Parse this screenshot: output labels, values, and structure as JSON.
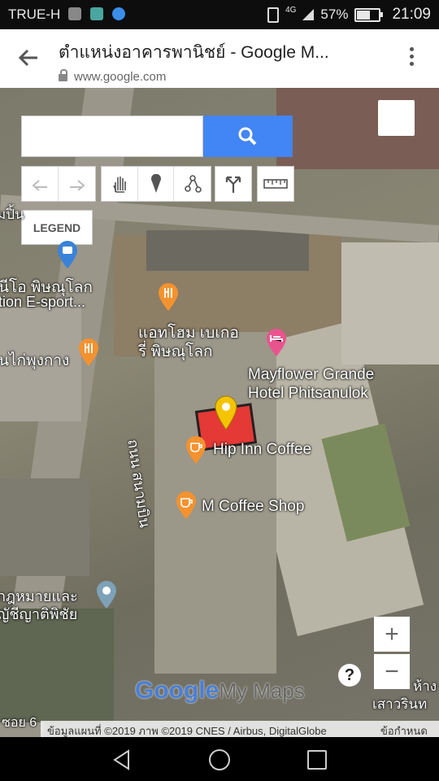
{
  "status_bar": {
    "carrier": "TRUE-H",
    "network": "4G",
    "battery": "57%",
    "battery_level": 0.57,
    "time": "21:09"
  },
  "browser": {
    "title": "ตำแหน่งอาคารพานิชย์ - Google M...",
    "url": "www.google.com"
  },
  "map": {
    "search": {
      "placeholder": "",
      "value": ""
    },
    "legend_label": "LEGEND",
    "zoom_in": "+",
    "zoom_out": "−",
    "help": "?",
    "labels": {
      "top_left_partial": "มปิ้น",
      "place_left_1a": "นีโอ พิษณุโลก",
      "place_left_1b": "tion E-sport...",
      "place_left_2": "นไก่พุงกาง",
      "bakery_a": "แอทโฮม เบเกอ",
      "bakery_b": "รี่ พิษณุโลก",
      "hotel_a": "Mayflower Grande",
      "hotel_b": "Hotel Phitsanulok",
      "cafe_1": "Hip Inn Coffee",
      "cafe_2": "M Coffee Shop",
      "road": "ถนน สนามบิน",
      "law_a": "กฎหมายและ",
      "law_b": "ญัชีญาติพิชัย",
      "right_a": "ห้าง",
      "right_b": "เสาวรินท",
      "soi": "ซอย 6",
      "brand_google": "Google",
      "brand_mymaps": "My Maps"
    },
    "attribution": {
      "text": "ข้อมูลแผนที่ ©2019 ภาพ ©2019 CNES / Airbus, DigitalGlobe",
      "terms": "ข้อกำหนด"
    }
  },
  "colors": {
    "search_button": "#4285f4",
    "poi_orange": "#f4922f",
    "poi_pink": "#e9548e",
    "marker_yellow": "#f5c400",
    "polygon_red": "#e53935"
  }
}
